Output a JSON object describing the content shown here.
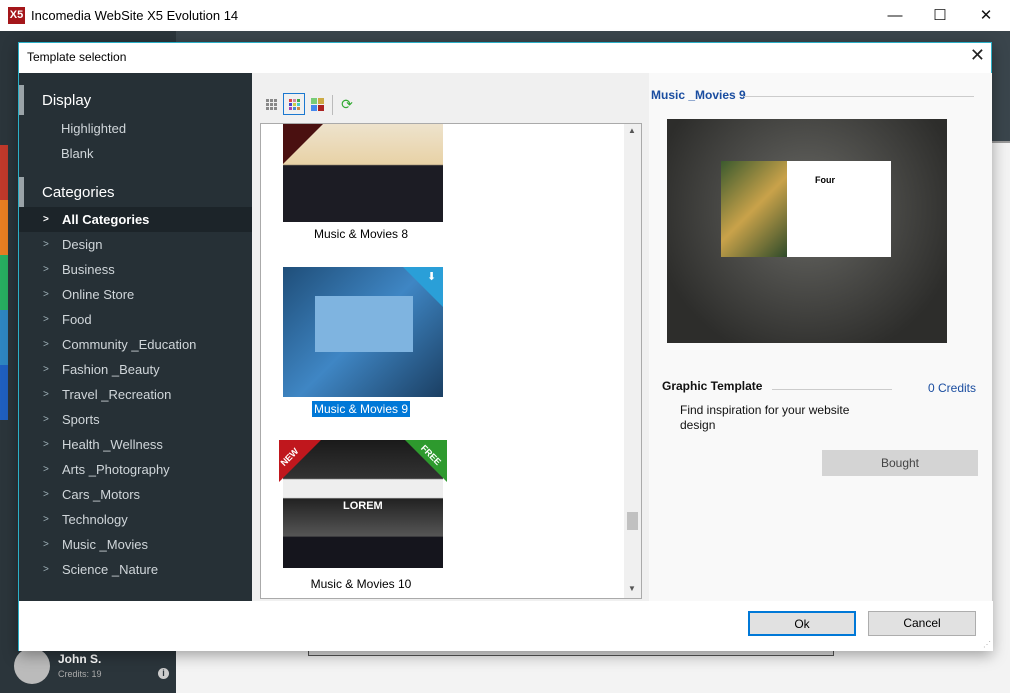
{
  "app": {
    "title": "Incomedia WebSite X5 Evolution 14",
    "minimize": "—",
    "maximize": "☐",
    "close": "✕"
  },
  "user": {
    "name": "John S.",
    "credits": "Credits: 19",
    "info": "i"
  },
  "dialog": {
    "title": "Template selection",
    "close": "✕",
    "display": {
      "heading": "Display",
      "options": [
        "Highlighted",
        "Blank"
      ]
    },
    "categories": {
      "heading": "Categories",
      "chevron": ">",
      "items": [
        "All Categories",
        "Design",
        "Business",
        "Online Store",
        "Food",
        "Community _Education",
        "Fashion _Beauty",
        "Travel _Recreation",
        "Sports",
        "Health _Wellness",
        "Arts _Photography",
        "Cars _Motors",
        "Technology",
        "Music _Movies",
        "Science _Nature"
      ],
      "selected": "All Categories"
    },
    "toolbar": {
      "views": [
        "small-grid-icon",
        "medium-grid-icon",
        "large-grid-icon"
      ],
      "refresh": "refresh-icon",
      "active_view": "medium-grid-icon"
    },
    "templates": [
      {
        "name": "Music & Movies 8",
        "badges": []
      },
      {
        "name": "Music & Movies 9",
        "badges": [
          "download"
        ],
        "selected": true
      },
      {
        "name": "Music & Movies 10",
        "badges": [
          "NEW",
          "FREE"
        ],
        "thumb_text": "LOREM"
      }
    ],
    "scroll": {
      "up": "▲",
      "down": "▼"
    },
    "preview": {
      "title": "Music _Movies 9",
      "heading": "Four",
      "type": "Graphic Template",
      "credits": "0 Credits",
      "description": "Find inspiration for your website design",
      "status_button": "Bought"
    },
    "footer": {
      "ok": "Ok",
      "cancel": "Cancel"
    }
  },
  "colors": {
    "accent": "#0078d7",
    "sidebar": "#263036",
    "link": "#1a4da0",
    "brand": "#a4161a"
  }
}
